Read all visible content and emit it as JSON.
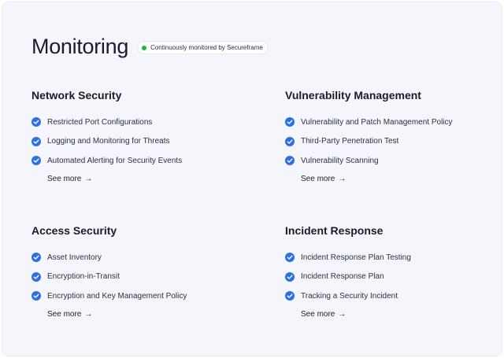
{
  "header": {
    "title": "Monitoring",
    "badge": "Continuously monitored by Secureframe",
    "badge_color": "#22b34a"
  },
  "accent_color": "#2f6fe4",
  "sections": [
    {
      "title": "Network Security",
      "items": [
        "Restricted Port Configurations",
        "Logging and Monitoring for Threats",
        "Automated Alerting for Security Events"
      ],
      "see_more": "See more"
    },
    {
      "title": "Vulnerability Management",
      "items": [
        "Vulnerability and Patch Management Policy",
        "Third-Party Penetration Test",
        "Vulnerability Scanning"
      ],
      "see_more": "See more"
    },
    {
      "title": "Access Security",
      "items": [
        "Asset Inventory",
        "Encryption-in-Transit",
        "Encryption and Key Management Policy"
      ],
      "see_more": "See more"
    },
    {
      "title": "Incident Response",
      "items": [
        "Incident Response Plan Testing",
        "Incident Response Plan",
        "Tracking a Security Incident"
      ],
      "see_more": "See more"
    }
  ],
  "icons": {
    "check": "check-circle-icon",
    "arrow": "arrow-right-icon"
  }
}
